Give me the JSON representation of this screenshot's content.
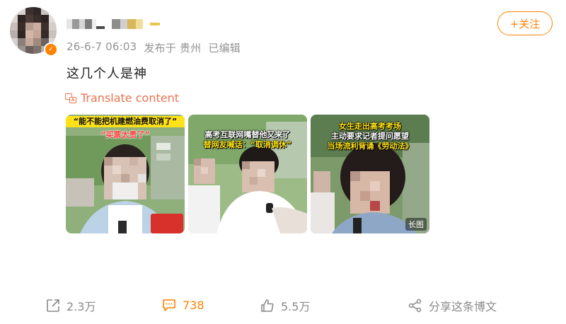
{
  "post": {
    "meta": {
      "timestamp": "26-6-7 06:03",
      "location": "发布于 贵州",
      "edited": "已编辑"
    },
    "follow_label": "+关注",
    "text": "这几个人是神",
    "translate_label": "Translate content",
    "images": [
      {
        "caption_top": "“能不能把机建燃油费取消了”",
        "caption_sub": "“买票太贵了”"
      },
      {
        "caption_line1": "高考互联网嘴替他又来了",
        "caption_line2": "替网友喊话：“取消调休”"
      },
      {
        "caption_line1": "女生走出高考考场",
        "caption_line2": "主动要求记者提问愿望",
        "caption_line3": "当场流利背诵《劳动法》",
        "badge": "长图"
      }
    ]
  },
  "actions": {
    "share_count": "2.3万",
    "comment_count": "738",
    "like_count": "5.5万",
    "forward_label": "分享这条博文"
  },
  "colors": {
    "accent": "#ff8200",
    "translate": "#eb7350",
    "meta_text": "#939393"
  }
}
